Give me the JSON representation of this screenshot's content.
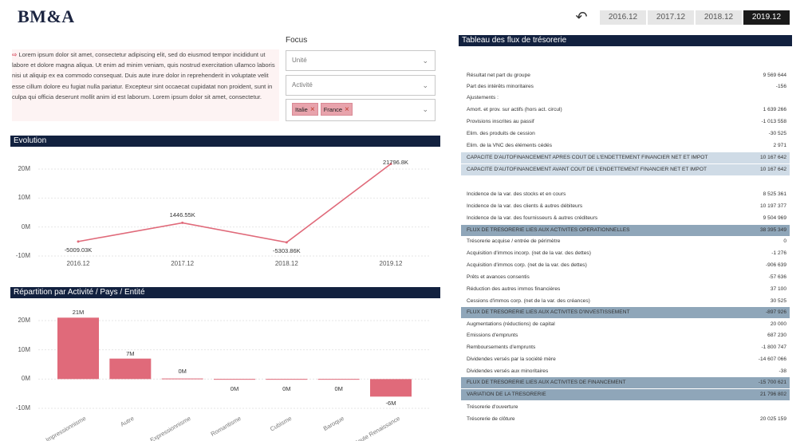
{
  "header": {
    "logo": "BM&A",
    "years": [
      "2016.12",
      "2017.12",
      "2018.12",
      "2019.12"
    ],
    "active_year": "2019.12"
  },
  "intro": {
    "arrow": "⇨",
    "text": "Lorem ipsum dolor sit amet, consectetur adipiscing elit, sed do eiusmod tempor incididunt ut labore et dolore magna aliqua. Ut enim ad minim veniam, quis nostrud exercitation ullamco laboris nisi ut aliquip ex ea commodo consequat. Duis aute irure dolor in reprehenderit in voluptate velit esse cillum dolore eu fugiat nulla pariatur. Excepteur sint occaecat cupidatat non proident, sunt in culpa qui officia deserunt mollit anim id est laborum. Lorem ipsum dolor sit amet, consectetur."
  },
  "focus": {
    "title": "Focus",
    "unit_placeholder": "Unité",
    "activity_placeholder": "Activité",
    "chips": [
      "Italie",
      "France"
    ]
  },
  "evolution": {
    "title": "Evolution"
  },
  "repartition": {
    "title": "Répartition par Activité / Pays / Entité"
  },
  "cashflow": {
    "title": "Tableau des flux de trésorerie",
    "rows": [
      {
        "label": "Résultat net part du groupe",
        "value": "9 569 644",
        "style": ""
      },
      {
        "label": "Part des intérêts minoritaires",
        "value": "-156",
        "style": ""
      },
      {
        "label": "Ajustements :",
        "value": "",
        "style": ""
      },
      {
        "label": "Amort. et prov. sur actifs (hors act. circul)",
        "value": "1 639 266",
        "style": ""
      },
      {
        "label": "Provisions inscrites au passif",
        "value": "-1 013 558",
        "style": ""
      },
      {
        "label": "Elim. des produits de cession",
        "value": "-30 525",
        "style": ""
      },
      {
        "label": "Elim. de la VNC des éléments cédés",
        "value": "2 971",
        "style": ""
      },
      {
        "label": "CAPACITE D'AUTOFINANCEMENT APRES COUT DE L'ENDETTEMENT FINANCIER NET ET IMPOT",
        "value": "10 167 642",
        "style": "hl-light"
      },
      {
        "label": "CAPACITE D'AUTOFINANCEMENT AVANT COUT DE L'ENDETTEMENT FINANCIER NET ET IMPOT",
        "value": "10 167 642",
        "style": "hl-light"
      },
      {
        "label": "",
        "value": "",
        "style": ""
      },
      {
        "label": "Incidence de la var. des stocks et en cours",
        "value": "8 525 361",
        "style": ""
      },
      {
        "label": "Incidence de la var. des clients & autres débiteurs",
        "value": "10 197 377",
        "style": ""
      },
      {
        "label": "Incidence de la var. des fournisseurs & autres créditeurs",
        "value": "9 504 969",
        "style": ""
      },
      {
        "label": "FLUX DE TRESORERIE LIES AUX ACTIVITES OPERATIONNELLES",
        "value": "38 395 349",
        "style": "hl-dark"
      },
      {
        "label": "Trésorerie acquise / entrée de périmètre",
        "value": "0",
        "style": ""
      },
      {
        "label": "Acquisition d'immos incorp. (net de la var. des dettes)",
        "value": "-1 276",
        "style": ""
      },
      {
        "label": "Acquisition d'immos corp. (net de la var. des dettes)",
        "value": "-906 639",
        "style": ""
      },
      {
        "label": "Prêts et avances consentis",
        "value": "-57 636",
        "style": ""
      },
      {
        "label": "Réduction des autres immos financières",
        "value": "37 100",
        "style": ""
      },
      {
        "label": "Cessions d'immos corp. (net de la var. des créances)",
        "value": "30 525",
        "style": ""
      },
      {
        "label": "FLUX DE TRESORERIE LIES AUX ACTIVITES D'INVESTISSEMENT",
        "value": "-897 926",
        "style": "hl-dark"
      },
      {
        "label": "Augmentations (réductions) de capital",
        "value": "20 000",
        "style": ""
      },
      {
        "label": "Emissions d'emprunts",
        "value": "687 230",
        "style": ""
      },
      {
        "label": "Remboursements d'emprunts",
        "value": "-1 800 747",
        "style": ""
      },
      {
        "label": "Dividendes versés par la société mère",
        "value": "-14 607 066",
        "style": ""
      },
      {
        "label": "Dividendes versés aux minoritaires",
        "value": "-38",
        "style": ""
      },
      {
        "label": "FLUX DE TRESORERIE LIES AUX ACTIVITES DE FINANCEMENT",
        "value": "-15 700 621",
        "style": "hl-dark"
      },
      {
        "label": "VARIATION DE LA TRESORERIE",
        "value": "21 796 802",
        "style": "hl-dark"
      },
      {
        "label": "Trésorerie d'ouverture",
        "value": "",
        "style": ""
      },
      {
        "label": "Trésorerie de clôture",
        "value": "20 025 159",
        "style": ""
      }
    ]
  },
  "chart_data": [
    {
      "type": "line",
      "title": "Evolution",
      "categories": [
        "2016.12",
        "2017.12",
        "2018.12",
        "2019.12"
      ],
      "values": [
        -5009.03,
        1446.55,
        -5303.86,
        21796.8
      ],
      "data_labels": [
        "-5009.03K",
        "1446.55K",
        "-5303.86K",
        "21796.8K"
      ],
      "yticks": [
        "20M",
        "10M",
        "0M",
        "-10M"
      ],
      "ylim": [
        -10000,
        20000
      ],
      "color": "#e06a7a",
      "grid": true
    },
    {
      "type": "bar",
      "title": "Répartition par Activité / Pays / Entité",
      "categories": [
        "Impressionnisme",
        "Autre",
        "Expressionnisme",
        "Romantisme",
        "Cubisme",
        "Baroque",
        "Haute Renaissance"
      ],
      "values": [
        21,
        7,
        0.2,
        0.05,
        0.05,
        0.05,
        -6
      ],
      "data_labels": [
        "21M",
        "7M",
        "0M",
        "0M",
        "0M",
        "0M",
        "-6M"
      ],
      "yticks": [
        "20M",
        "10M",
        "0M",
        "-10M"
      ],
      "ylim": [
        -10,
        20
      ],
      "color": "#e06a7a",
      "grid": true
    }
  ]
}
